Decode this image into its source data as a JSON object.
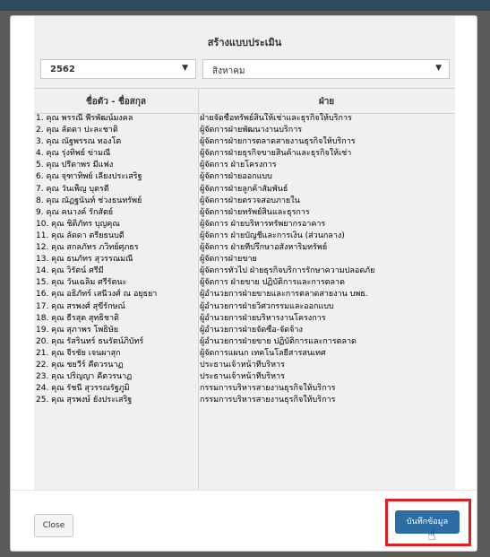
{
  "modal": {
    "title": "สร้างแบบประเมิน",
    "year_select": {
      "value": "2562",
      "arrow": "▼"
    },
    "month_select": {
      "value": "สิงหาคม",
      "arrow": "▼"
    },
    "table": {
      "columns": [
        "ชื่อตัว - ชื่อสกุล",
        "ฝ่าย"
      ],
      "rows": [
        {
          "name": "1. คุณ พรรณี พีรพัฒน์มงคล",
          "dept": "ฝ่ายจัดซื้อทรัพย์สินให้เช่าและธุรกิจให้บริการ"
        },
        {
          "name": "2. คุณ ลัดดา ปะละชาติ",
          "dept": "ผู้จัดการฝ่ายพัฒนางานบริการ"
        },
        {
          "name": "3. คุณ ณัฐพรรณ ทองโต",
          "dept": "ผู้จัดการฝ่ายการตลาดสายงานธุรกิจให้บริการ"
        },
        {
          "name": "4. คุณ รุ่งทิพย์ ข่ามณี",
          "dept": "ผู้จัดการฝ่ายธุรกิจขายสินค้าและธุรกิจให้เช่า"
        },
        {
          "name": "5. คุณ ปรีดาพร มีแฟง",
          "dept": "ผู้จัดการ ฝ่ายโครงการ"
        },
        {
          "name": "6. คุณ จุฑาทิพย์ เลี่ยงประเสริฐ",
          "dept": "ผู้จัดการฝ่ายออกแบบ"
        },
        {
          "name": "7. คุณ วันเพ็ญ บุตรดี",
          "dept": "ผู้จัดการฝ่ายลูกค้าสัมพันธ์"
        },
        {
          "name": "8. คุณ ณัฏฐนันท์ ช่วงธนทรัพย์",
          "dept": "ผู้จัดการฝ่ายตรวจสอบภายใน"
        },
        {
          "name": "9. คุณ คนางค์ รักสัตย์",
          "dept": "ผู้จัดการฝ่ายทรัพย์สินและธุรการ"
        },
        {
          "name": "10. คุณ ชิติภัทร บุญคุณ",
          "dept": "ผู้จัดการ ฝ่ายบริหารทรัพยากรอาคาร"
        },
        {
          "name": "11. คุณ ลัดดา ตรียธนบดี",
          "dept": "ผู้จัดการ ฝ่ายบัญชีและการเงิน (ส่วนกลาง)"
        },
        {
          "name": "12. คุณ สกลภัทร ภวิทย์ศุภธร",
          "dept": "ผู้จัดการ ฝ่ายที่ปรึกษาอสังหาริมทรัพย์"
        },
        {
          "name": "13. คุณ ธนภัทร สุวรรณมณี",
          "dept": "ผู้จัดการฝ่ายขาย"
        },
        {
          "name": "14. คุณ วิรัตน์ ศรีมี",
          "dept": "ผู้จัดการทั่วไป ฝ่ายธุรกิจบริการรักษาความปลอดภัย"
        },
        {
          "name": "15. คุณ วันเฉลิม ศรีรัตนะ",
          "dept": "ผู้จัดการ ฝ่ายขาย ปฏิบัติการและการตลาด"
        },
        {
          "name": "16. คุณ อธิภัทร์ เสนีวงศ์ ณ อยุธยา",
          "dept": "ผู้อำนวยการฝ่ายขายและการตลาดสายงาน บพธ."
        },
        {
          "name": "17. คุณ สรพงศ์ สุขีรักษณ์",
          "dept": "ผู้อำนวยการฝ่ายวิศวกรรมและออกแบบ"
        },
        {
          "name": "18. คุณ ธีรสุต สุทธิชาติ",
          "dept": "ผู้อำนวยการฝ่ายบริหารงานโครงการ"
        },
        {
          "name": "19. คุณ สุภาพร โพธิษัย",
          "dept": "ผู้อำนวยการฝ่ายจัดซื้อ-จัดจ้าง"
        },
        {
          "name": "20. คุณ รัสรินทร์ ธนรัตน์ภิบัทร์",
          "dept": "ผู้อำนวยการฝ่ายขาย ปฏิบัติการและการตลาด"
        },
        {
          "name": "21. คุณ จีรชัย เจนผาสุก",
          "dept": "ผู้จัดการแผนก เทคโนโลยีสารสนเทศ"
        },
        {
          "name": "22. คุณ ชยวีร์ คีตวรนาฏ",
          "dept": "ประธานเจ้าหน้าที่บริหาร"
        },
        {
          "name": "23. คุณ ปริญญา คีตวรนาฏ",
          "dept": "ประธานเจ้าหน้าที่บริหาร"
        },
        {
          "name": "24. คุณ รัชนี สุวรรณรัฐภูมิ",
          "dept": "กรรมการบริหารสายงานธุรกิจให้บริการ"
        },
        {
          "name": "25. คุณ สุรพงษ์ ยังประเสริฐ",
          "dept": "กรรมการบริหารสายงานธุรกิจให้บริการ"
        }
      ]
    },
    "footer": {
      "close_label": "Close",
      "save_label": "บันทึกข้อมูล"
    }
  },
  "colors": {
    "primary": "#2e6da4",
    "highlight": "#e02020",
    "backdrop": "#5a5a5a"
  },
  "icons": {
    "cursor": "hand-pointer-icon"
  }
}
